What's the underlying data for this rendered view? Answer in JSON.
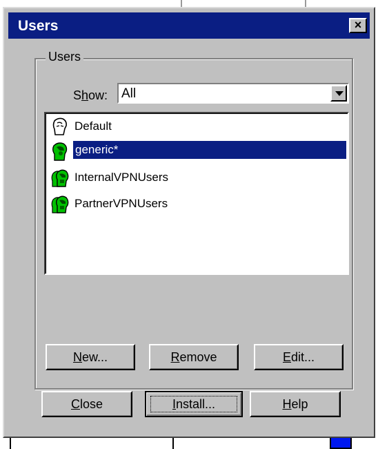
{
  "window": {
    "title": "Users",
    "close_label": "×"
  },
  "group": {
    "label": "Users"
  },
  "show": {
    "label_prefix": "S",
    "label_ul": "h",
    "label_rest": "ow:",
    "value": "All"
  },
  "users": [
    {
      "name": "Default",
      "icon": "default-user-icon",
      "selected": false
    },
    {
      "name": "generic*",
      "icon": "user-icon",
      "selected": true
    },
    {
      "name": "InternalVPNUsers",
      "icon": "user-group-icon",
      "selected": false
    },
    {
      "name": "PartnerVPNUsers",
      "icon": "user-group-icon",
      "selected": false
    }
  ],
  "buttons": {
    "new": {
      "ul": "N",
      "rest": "ew..."
    },
    "remove": {
      "ul": "R",
      "rest": "emove"
    },
    "edit": {
      "ul": "E",
      "rest": "dit..."
    },
    "close": {
      "ul": "C",
      "rest": "lose"
    },
    "install": {
      "ul": "I",
      "rest": "nstall..."
    },
    "help": {
      "ul": "H",
      "rest": "elp"
    }
  },
  "colors": {
    "selection": "#0a1e83",
    "icon_green": "#00c000"
  }
}
